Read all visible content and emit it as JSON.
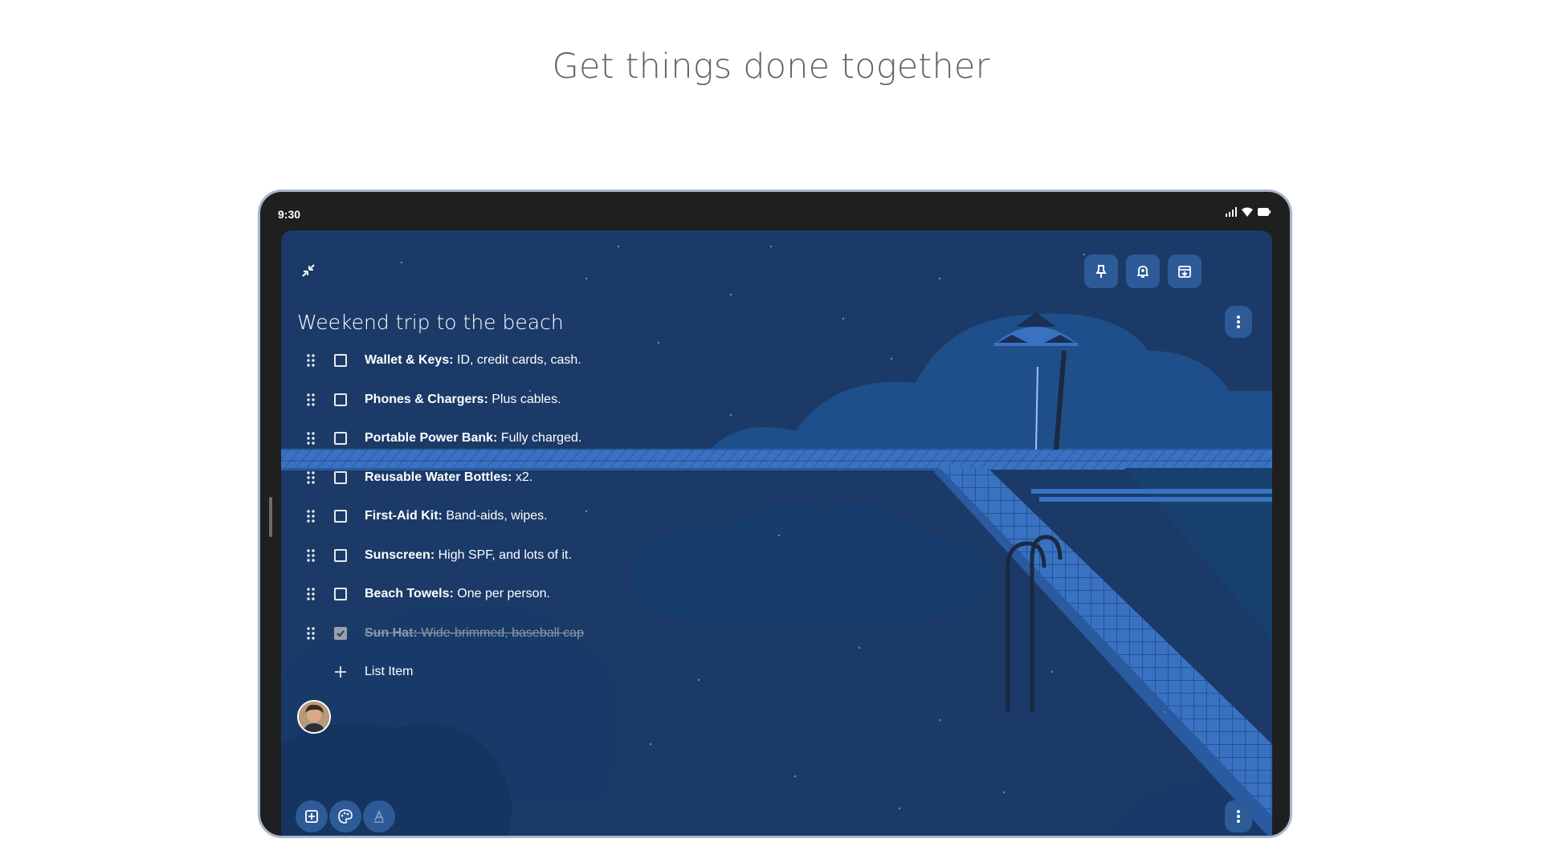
{
  "headline": "Get things done together",
  "status_bar": {
    "time": "9:30",
    "icons": [
      "signal-icon",
      "wifi-icon",
      "battery-icon"
    ]
  },
  "toolbar": {
    "collapse_icon": "collapse-icon",
    "buttons": [
      "pin-icon",
      "reminder-icon",
      "archive-icon"
    ]
  },
  "note": {
    "title": "Weekend trip to the beach",
    "items": [
      {
        "label": "Wallet & Keys:",
        "detail": " ID, credit cards, cash.",
        "checked": false
      },
      {
        "label": "Phones & Chargers:",
        "detail": " Plus cables.",
        "checked": false
      },
      {
        "label": "Portable Power Bank:",
        "detail": " Fully charged.",
        "checked": false
      },
      {
        "label": "Reusable Water Bottles:",
        "detail": " x2.",
        "checked": false
      },
      {
        "label": "First-Aid Kit:",
        "detail": " Band-aids, wipes.",
        "checked": false
      },
      {
        "label": "Sunscreen:",
        "detail": " High SPF, and lots of it.",
        "checked": false
      },
      {
        "label": "Beach Towels:",
        "detail": " One per person.",
        "checked": false
      },
      {
        "label": "Sun Hat:",
        "detail": " Wide-brimmed, baseball cap",
        "checked": true
      }
    ],
    "add_item_label": "List Item"
  },
  "bottom_bar": {
    "buttons": [
      "add-box-icon",
      "palette-icon",
      "text-format-icon"
    ],
    "more_icon": "more-vert-icon"
  },
  "colors": {
    "background": "#1b3a68",
    "button": "#2d5b98",
    "pool_tile": "#3a72c2"
  }
}
